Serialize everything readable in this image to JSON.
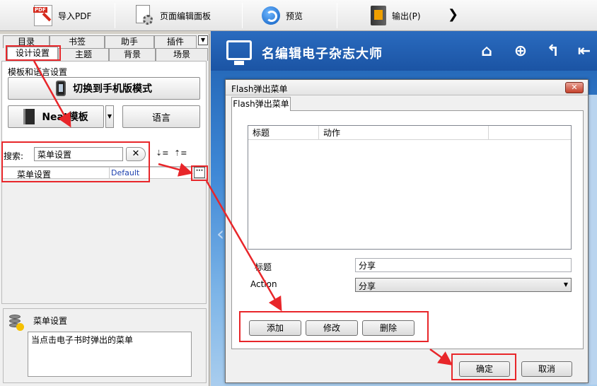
{
  "toolbar": {
    "import_pdf": "导入PDF",
    "page_editor": "页面编辑面板",
    "preview": "预览",
    "export": "输出(P)",
    "more": "❯"
  },
  "left_panel": {
    "tabs_row1": [
      "目录",
      "书签",
      "助手",
      "插件"
    ],
    "tabs_row2": [
      "设计设置",
      "主题",
      "背景",
      "场景"
    ],
    "active_tab": "设计设置",
    "group_label": "模板和语言设置",
    "mobile_mode_button": "切换到手机版模式",
    "template_button": "Neat模板",
    "language_button": "语言",
    "search_label": "搜索:",
    "search_value": "菜单设置",
    "clear_button": "✕",
    "property": {
      "name": "菜单设置",
      "value": "Default"
    },
    "ellipsis_button": "···",
    "desc_title": "菜单设置",
    "desc_text": "当点击电子书时弹出的菜单"
  },
  "app_header": {
    "brand": "名编辑电子杂志大师",
    "icons": [
      "home-icon",
      "zoom-in-icon",
      "back-icon",
      "first-page-icon"
    ]
  },
  "dialog": {
    "title": "Flash弹出菜单",
    "tab": "Flash弹出菜单",
    "columns": [
      "标题",
      "动作"
    ],
    "title_label": "标题",
    "title_value": "分享",
    "action_label": "Action",
    "action_value": "分享",
    "add_button": "添加",
    "edit_button": "修改",
    "delete_button": "删除",
    "ok_button": "确定",
    "cancel_button": "取消"
  },
  "colors": {
    "annotation": "#e8262a",
    "header_blue": "#1b54a4"
  }
}
